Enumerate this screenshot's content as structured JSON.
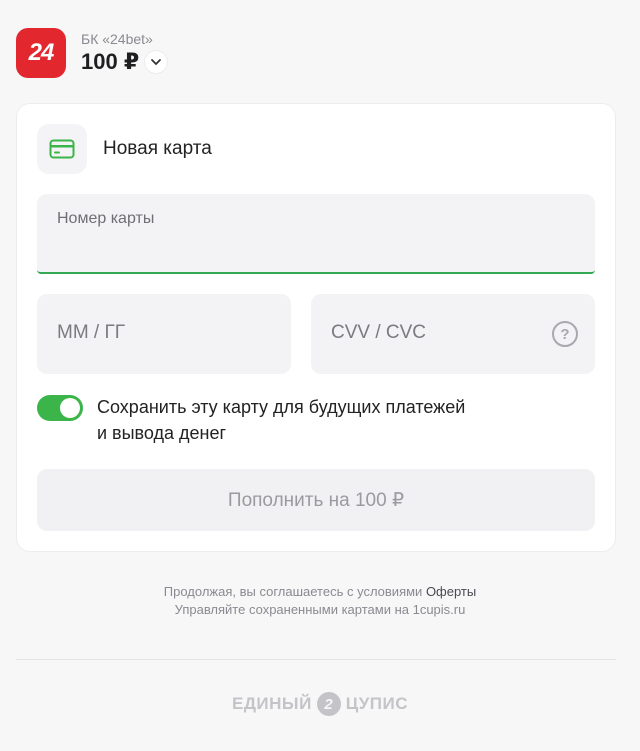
{
  "header": {
    "logo_text": "24",
    "merchant_name": "БК «24bet»",
    "amount": "100 ₽"
  },
  "method": {
    "label": "Новая карта",
    "icon": "card-icon"
  },
  "form": {
    "card_number_placeholder": "Номер карты",
    "expiry_placeholder": "ММ / ГГ",
    "cvv_placeholder": "CVV / CVC",
    "help_icon": "question-icon",
    "save_card_label_line1": "Сохранить эту карту для будущих платежей",
    "save_card_label_line2": "и вывода денег",
    "save_card_enabled": true,
    "submit_label": "Пополнить на 100 ₽"
  },
  "footer": {
    "terms_prefix": "Продолжая, вы соглашаетесь с условиями",
    "terms_link": "Оферты",
    "manage_cards": "Управляйте сохраненными картами на 1cupis.ru",
    "brand_left": "ЕДИНЫЙ",
    "brand_mark": "2",
    "brand_right": "ЦУПИС"
  },
  "colors": {
    "accent_green": "#3bb54a",
    "logo_red": "#e3272e"
  }
}
